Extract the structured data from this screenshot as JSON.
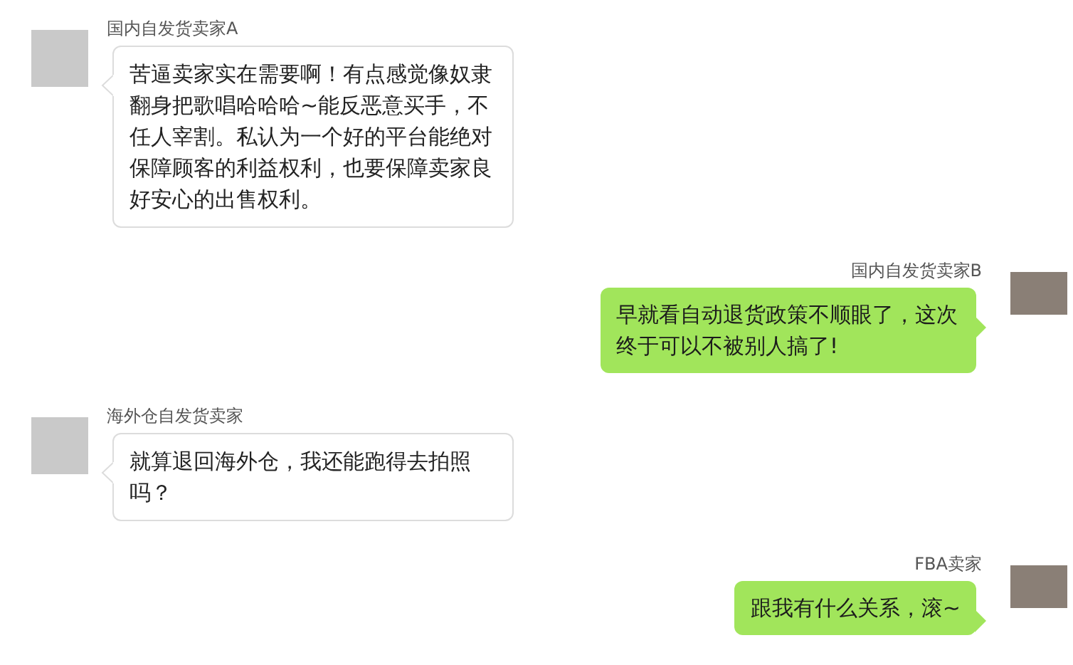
{
  "messages": [
    {
      "kind": "incoming",
      "sender": "国内自发货卖家A",
      "text": "苦逼卖家实在需要啊！有点感觉像奴隶翻身把歌唱哈哈哈~能反恶意买手，不任人宰割。私认为一个好的平台能绝对保障顾客的利益权利，也要保障卖家良好安心的出售权利。"
    },
    {
      "kind": "outgoing",
      "sender": "国内自发货卖家B",
      "text": "早就看自动退货政策不顺眼了，这次终于可以不被别人搞了!"
    },
    {
      "kind": "incoming",
      "sender": "海外仓自发货卖家",
      "text": "就算退回海外仓，我还能跑得去拍照吗？"
    },
    {
      "kind": "outgoing",
      "sender": "FBA卖家",
      "text": "跟我有什么关系，滚~"
    }
  ]
}
